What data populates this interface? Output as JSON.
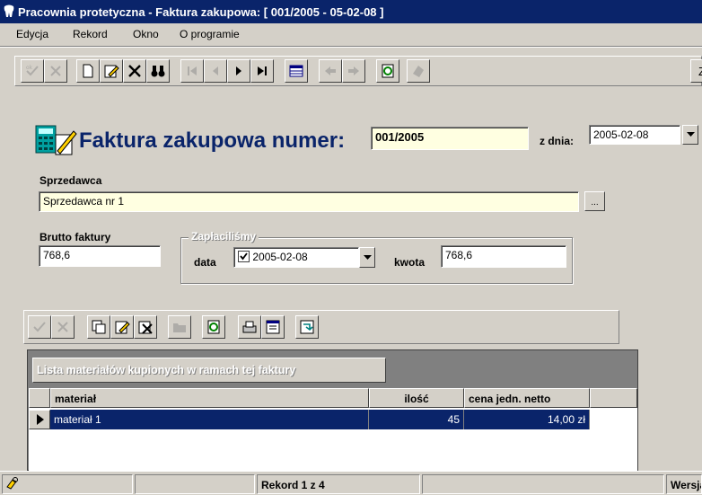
{
  "window": {
    "title": "Pracownia protetyczna - Faktura zakupowa:  [ 001/2005 - 05-02-08 ]"
  },
  "menu": [
    "Edycja",
    "Rekord",
    "Okno",
    "O programie"
  ],
  "main_toolbar": {
    "buttons": [
      {
        "name": "confirm-button",
        "icon": "check-icon",
        "enabled": false
      },
      {
        "name": "cancel-button",
        "icon": "x-icon",
        "enabled": false
      },
      {
        "name": "new-record-button",
        "icon": "new-doc-icon",
        "enabled": true
      },
      {
        "name": "edit-record-button",
        "icon": "edit-icon",
        "enabled": true
      },
      {
        "name": "delete-record-button",
        "icon": "delete-icon",
        "enabled": true
      },
      {
        "name": "find-button",
        "icon": "binoculars-icon",
        "enabled": true
      },
      {
        "name": "first-record-button",
        "icon": "first-icon",
        "enabled": false
      },
      {
        "name": "prev-record-button",
        "icon": "prev-icon",
        "enabled": false
      },
      {
        "name": "next-record-button",
        "icon": "next-icon",
        "enabled": true
      },
      {
        "name": "last-record-button",
        "icon": "last-icon",
        "enabled": true
      },
      {
        "name": "table-view-button",
        "icon": "table-icon",
        "enabled": true
      },
      {
        "name": "back-button",
        "icon": "arrow-left-icon",
        "enabled": false
      },
      {
        "name": "forward-button",
        "icon": "arrow-right-icon",
        "enabled": false
      },
      {
        "name": "refresh-button",
        "icon": "refresh-icon",
        "enabled": true
      },
      {
        "name": "print-button",
        "icon": "print-icon",
        "enabled": false
      }
    ],
    "right_button_label": "Z"
  },
  "form": {
    "heading": "Faktura zakupowa numer:",
    "number_value": "001/2005",
    "date_label": "z dnia:",
    "date_value": "2005-02-08",
    "seller_label": "Sprzedawca",
    "seller_value": "Sprzedawca nr 1",
    "seller_button_label": "...",
    "gross_label": "Brutto faktury",
    "gross_value": "768,6",
    "paid_group_label": "Zapłaciliśmy",
    "paid_date_label": "data",
    "paid_date_checked": true,
    "paid_date_value": "2005-02-08",
    "paid_amount_label": "kwota",
    "paid_amount_value": "768,6"
  },
  "grid_toolbar": {
    "buttons": [
      {
        "name": "grid-confirm-button",
        "icon": "check-icon",
        "enabled": false
      },
      {
        "name": "grid-cancel-button",
        "icon": "x-icon",
        "enabled": false
      },
      {
        "name": "grid-copy-button",
        "icon": "copy-icon",
        "enabled": true
      },
      {
        "name": "grid-edit-button",
        "icon": "edit-icon",
        "enabled": true
      },
      {
        "name": "grid-delete-button",
        "icon": "delete-icon",
        "enabled": true
      },
      {
        "name": "grid-open-button",
        "icon": "folder-icon",
        "enabled": false
      },
      {
        "name": "grid-refresh-button",
        "icon": "refresh-icon",
        "enabled": true
      },
      {
        "name": "grid-print-button",
        "icon": "printer-icon",
        "enabled": true
      },
      {
        "name": "grid-properties-button",
        "icon": "properties-icon",
        "enabled": true
      },
      {
        "name": "grid-export-button",
        "icon": "export-icon",
        "enabled": true
      }
    ]
  },
  "grid": {
    "caption": "Lista materiałów kupionych w ramach tej faktury",
    "columns": [
      "materiał",
      "ilość",
      "cena jedn. netto"
    ],
    "rows": [
      {
        "material": "materiał 1",
        "qty": "45",
        "price": "14,00 zł"
      }
    ]
  },
  "statusbar": {
    "record": "Rekord 1 z 4",
    "version": "Wersja"
  },
  "colors": {
    "titlebar": "#0a246a",
    "selection": "#0a246a",
    "heading": "#0a246a",
    "readonly_field": "#ffffe1"
  }
}
